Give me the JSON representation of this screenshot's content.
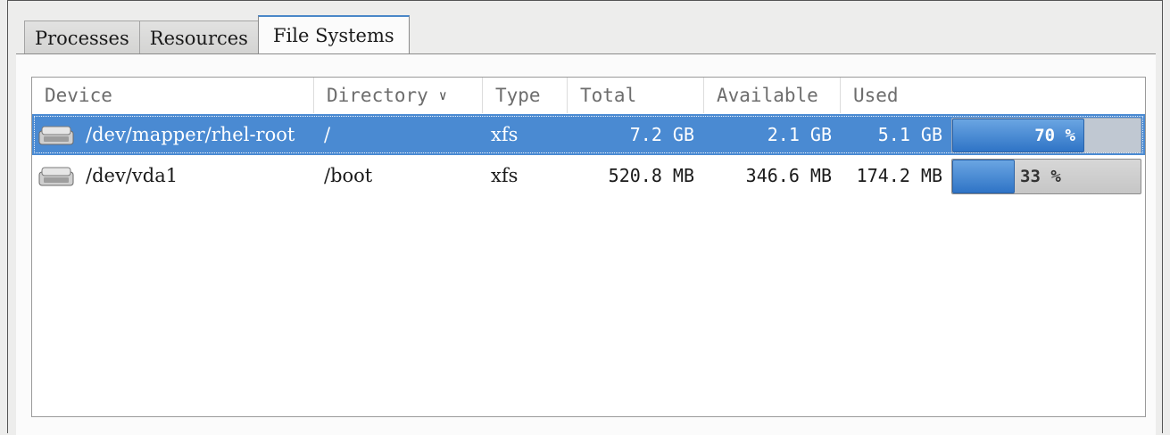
{
  "tabs": [
    "Processes",
    "Resources",
    "File Systems"
  ],
  "columns": {
    "device": "Device",
    "directory": "Directory",
    "type": "Type",
    "total": "Total",
    "available": "Available",
    "used": "Used"
  },
  "rows": [
    {
      "icon": "hard-drive-icon",
      "device": "/dev/mapper/rhel-root",
      "directory": "/",
      "type": "xfs",
      "total": "7.2 GB",
      "available": "2.1 GB",
      "used": "5.1 GB",
      "used_percent_label": "70 %",
      "used_percent": 70,
      "selected": true
    },
    {
      "icon": "hard-drive-icon",
      "device": "/dev/vda1",
      "directory": "/boot",
      "type": "xfs",
      "total": "520.8 MB",
      "available": "346.6 MB",
      "used": "174.2 MB",
      "used_percent_label": "33 %",
      "used_percent": 33,
      "selected": false
    }
  ],
  "colors": {
    "selection": "#4a8ad2",
    "bar_fill": "#3a7dcc",
    "active_tab_accent": "#4a87c8"
  }
}
